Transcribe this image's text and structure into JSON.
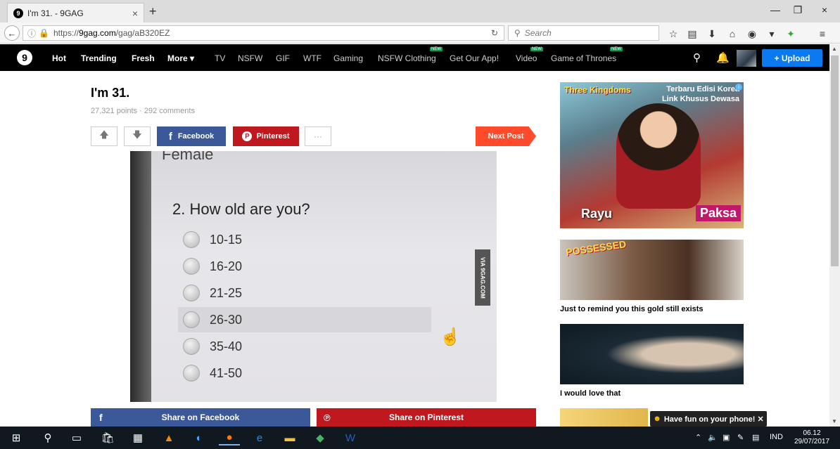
{
  "browser": {
    "tab_title": "I'm 31. - 9GAG",
    "tab_close": "×",
    "new_tab": "+",
    "url_prefix": "https://",
    "url_domain": "9gag.com",
    "url_path": "/gag/aB320EZ",
    "search_placeholder": "Search",
    "window_controls": [
      "—",
      "❐",
      "×"
    ]
  },
  "site_nav": {
    "items": [
      "Hot",
      "Trending",
      "Fresh",
      "More ▾",
      "TV",
      "NSFW",
      "GIF",
      "WTF",
      "Gaming",
      "NSFW Clothing",
      "Get Our App!",
      "Video",
      "Game of Thrones"
    ],
    "new_badge": "NEW",
    "upload_label": "+ Upload"
  },
  "post": {
    "title": "I'm 31.",
    "meta": "27,321 points · 292 comments",
    "facebook_label": "Facebook",
    "pinterest_label": "Pinterest",
    "more_label": "···",
    "next_post_label": "Next Post",
    "image": {
      "top_text": "Female",
      "question": "2. How old are you?",
      "options": [
        "10-15",
        "16-20",
        "21-25",
        "26-30",
        "35-40",
        "41-50"
      ],
      "watermark": "VIA 9GAG.COM"
    },
    "share_facebook": "Share on Facebook",
    "share_pinterest": "Share on Pinterest"
  },
  "sidebar": {
    "ad": {
      "logo": "Three Kingdoms",
      "headline_1": "Terbaru Edisi Korea",
      "headline_2": "Link Khusus Dewasa",
      "left_text": "Rayu",
      "right_text": "Paksa"
    },
    "thumb1_overlay": "POSSESSED",
    "items": [
      {
        "title": "Just to remind you this gold still exists"
      },
      {
        "title": "I would love that"
      }
    ],
    "toast": "Have fun on your phone! ✕"
  },
  "taskbar": {
    "language": "IND",
    "time": "06.12",
    "date": "29/07/2017"
  }
}
